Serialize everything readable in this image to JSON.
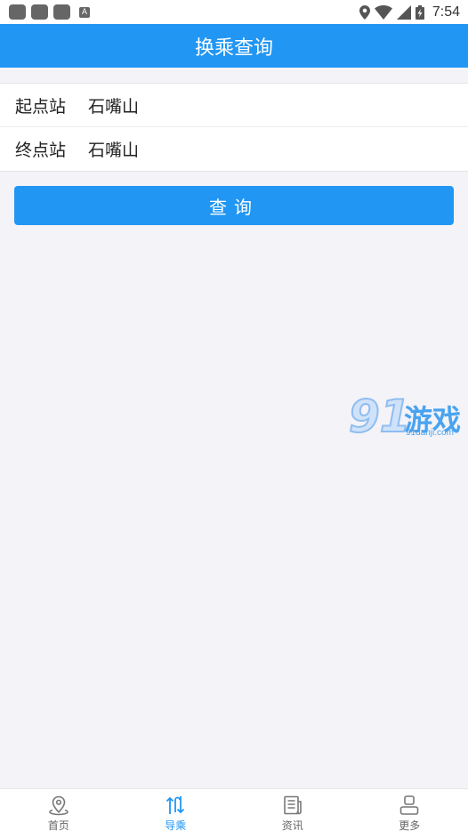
{
  "status_bar": {
    "time": "7:54",
    "notification_letter": "A"
  },
  "header": {
    "title": "换乘查询"
  },
  "form": {
    "start": {
      "label": "起点站",
      "value": "石嘴山"
    },
    "end": {
      "label": "终点站",
      "value": "石嘴山"
    }
  },
  "query_button": {
    "label": "查询"
  },
  "watermark": {
    "number": "91",
    "text": "游戏",
    "url": "91danji.com"
  },
  "bottom_nav": {
    "active": "导乘",
    "items": [
      {
        "label": "首页",
        "icon": "location-pin-icon"
      },
      {
        "label": "导乘",
        "icon": "transfer-arrows-icon"
      },
      {
        "label": "资讯",
        "icon": "newspaper-icon"
      },
      {
        "label": "更多",
        "icon": "user-icon"
      }
    ]
  },
  "colors": {
    "primary": "#2196f3",
    "background": "#f3f3f8",
    "text": "#222222"
  }
}
